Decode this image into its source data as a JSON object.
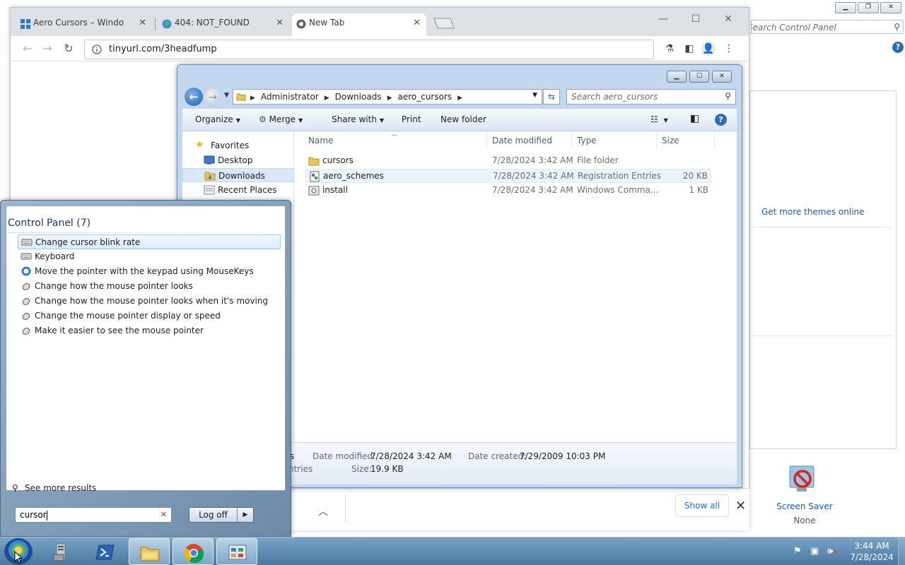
{
  "control_panel": {
    "search_placeholder": "Search Control Panel",
    "get_themes_link": "Get more themes online",
    "screen_saver_label": "Screen Saver",
    "screen_saver_value": "None"
  },
  "browser": {
    "tabs": [
      {
        "title": "Aero Cursors – Windo",
        "icon": "windows-logo-icon",
        "close": "✕"
      },
      {
        "title": "404: NOT_FOUND",
        "icon": "globe-icon",
        "close": "✕"
      },
      {
        "title": "New Tab",
        "icon": "chrome-icon",
        "close": "✕",
        "active": true
      }
    ],
    "url": "tinyurl.com/3headfump",
    "window_controls": [
      "—",
      "☐",
      "✕"
    ],
    "download_shelf": {
      "show_all_label": "Show all",
      "close_label": "✕",
      "expand_label": "^"
    }
  },
  "explorer": {
    "breadcrumb": [
      "Administrator",
      "Downloads",
      "aero_cursors"
    ],
    "search_placeholder": "Search aero_cursors",
    "commands": {
      "organize": "Organize",
      "merge": "Merge",
      "share_with": "Share with",
      "print": "Print",
      "new_folder": "New folder"
    },
    "nav": {
      "favorites": "Favorites",
      "items": [
        "Desktop",
        "Downloads",
        "Recent Places"
      ]
    },
    "columns": {
      "name": "Name",
      "date": "Date modified",
      "type": "Type",
      "size": "Size"
    },
    "files": [
      {
        "name": "cursors",
        "date": "7/28/2024 3:42 AM",
        "type": "File folder",
        "size": "",
        "icon": "folder-icon"
      },
      {
        "name": "aero_schemes",
        "date": "7/28/2024 3:42 AM",
        "type": "Registration Entries",
        "size": "20 KB",
        "icon": "registry-file-icon"
      },
      {
        "name": "install",
        "date": "7/28/2024 3:42 AM",
        "type": "Windows Comma...",
        "size": "1 KB",
        "icon": "command-script-icon"
      }
    ],
    "details": {
      "partial_top": "s",
      "partial_bottom": "ntries",
      "date_modified_label": "Date modified:",
      "date_modified_value": "7/28/2024 3:42 AM",
      "date_created_label": "Date created:",
      "date_created_value": "7/29/2009 10:03 PM",
      "size_label": "Size:",
      "size_value": "19.9 KB"
    }
  },
  "start_menu": {
    "section_title": "Control Panel (7)",
    "results": [
      {
        "label": "Change cursor blink rate",
        "icon": "keyboard-icon",
        "selected": true
      },
      {
        "label": "Keyboard",
        "icon": "keyboard-icon"
      },
      {
        "label": "Move the pointer with the keypad using MouseKeys",
        "icon": "ease-of-access-icon"
      },
      {
        "label": "Change how the mouse pointer looks",
        "icon": "mouse-icon"
      },
      {
        "label": "Change how the mouse pointer looks when it's moving",
        "icon": "mouse-icon"
      },
      {
        "label": "Change the mouse pointer display or speed",
        "icon": "mouse-icon"
      },
      {
        "label": "Make it easier to see the mouse pointer",
        "icon": "mouse-icon"
      }
    ],
    "see_more": "See more results",
    "search_value": "cursor",
    "search_clear": "✕",
    "log_off": "Log off"
  },
  "taskbar": {
    "clock_time": "3:44 AM",
    "clock_date": "7/28/2024",
    "pinned": [
      "server-manager-icon",
      "powershell-icon",
      "explorer-icon",
      "chrome-icon",
      "control-panel-icon"
    ]
  }
}
